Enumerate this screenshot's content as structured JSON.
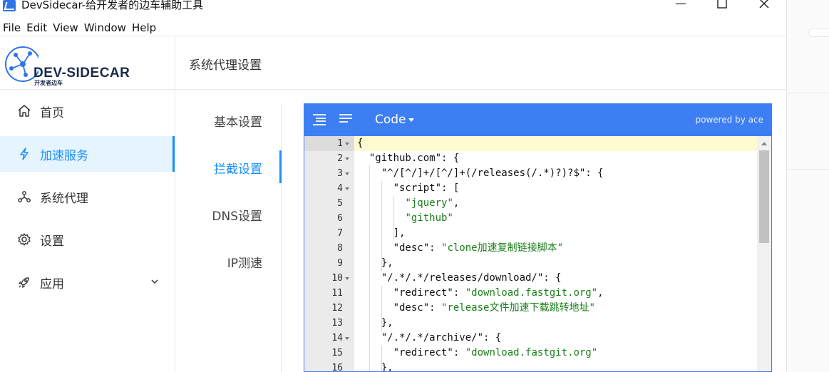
{
  "window": {
    "title": "DevSidecar-给开发者的边车辅助工具",
    "minimize": "—",
    "maximize": "☐",
    "close": "✕"
  },
  "menu": [
    "File",
    "Edit",
    "View",
    "Window",
    "Help"
  ],
  "logo": {
    "text": "DEV-SIDECAR",
    "sub": "开发者边车"
  },
  "sidebar": {
    "items": [
      {
        "label": "首页",
        "icon": "home-icon"
      },
      {
        "label": "加速服务",
        "icon": "lightning-icon",
        "active": true
      },
      {
        "label": "系统代理",
        "icon": "cluster-icon"
      },
      {
        "label": "设置",
        "icon": "gear-icon"
      },
      {
        "label": "应用",
        "icon": "rocket-icon",
        "expandable": true
      }
    ]
  },
  "page": {
    "title": "系统代理设置"
  },
  "subtabs": [
    {
      "label": "基本设置"
    },
    {
      "label": "拦截设置",
      "active": true
    },
    {
      "label": "DNS设置"
    },
    {
      "label": "IP测速"
    }
  ],
  "editor": {
    "mode_label": "Code",
    "powered": "powered by ace",
    "lines": [
      {
        "n": "1",
        "fold": true,
        "text": "{"
      },
      {
        "n": "2",
        "fold": true,
        "text": "  \"github.com\": {"
      },
      {
        "n": "3",
        "fold": true,
        "text": "    \"^/[^/]+/[^/]+(/releases(/.*)?)?$\": {"
      },
      {
        "n": "4",
        "fold": true,
        "text": "      \"script\": ["
      },
      {
        "n": "5",
        "fold": false,
        "text": "        \"jquery\","
      },
      {
        "n": "6",
        "fold": false,
        "text": "        \"github\""
      },
      {
        "n": "7",
        "fold": false,
        "text": "      ],"
      },
      {
        "n": "8",
        "fold": false,
        "text": "      \"desc\": \"clone加速复制链接脚本\""
      },
      {
        "n": "9",
        "fold": false,
        "text": "    },"
      },
      {
        "n": "10",
        "fold": true,
        "text": "    \"/.*/.*/releases/download/\": {"
      },
      {
        "n": "11",
        "fold": false,
        "text": "      \"redirect\": \"download.fastgit.org\","
      },
      {
        "n": "12",
        "fold": false,
        "text": "      \"desc\": \"release文件加速下载跳转地址\""
      },
      {
        "n": "13",
        "fold": false,
        "text": "    },"
      },
      {
        "n": "14",
        "fold": true,
        "text": "    \"/.*/.*/archive/\": {"
      },
      {
        "n": "15",
        "fold": false,
        "text": "      \"redirect\": \"download.fastgit.org\""
      },
      {
        "n": "16",
        "fold": false,
        "text": "    },"
      }
    ]
  },
  "colors": {
    "accent": "#1890ff",
    "editor_toolbar": "#3d7ff3",
    "string": "#1a7f1a",
    "active_line": "#fffbd1"
  }
}
